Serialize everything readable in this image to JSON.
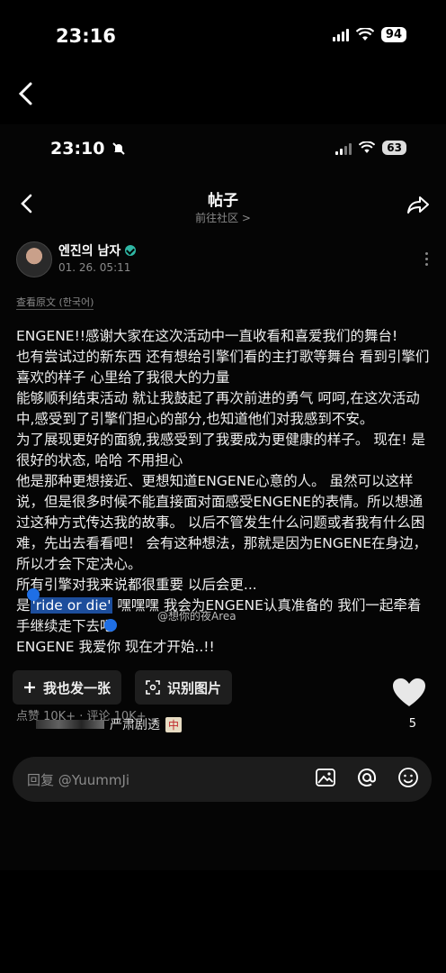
{
  "outer_status": {
    "time": "23:16",
    "battery": "94"
  },
  "inner_status": {
    "time": "23:10",
    "battery": "63"
  },
  "nav": {
    "title": "帖子",
    "subtitle": "前往社区 >"
  },
  "post": {
    "author": "엔진의 남자",
    "date": "01. 26. 05:11",
    "view_original": "查看原文 (한국어)",
    "paragraphs": [
      "ENGENE!!感谢大家在这次活动中一直收看和喜爱我们的舞台!",
      "也有尝试过的新东西 还有想给引擎们看的主打歌等舞台 看到引擎们喜欢的样子 心里给了我很大的力量",
      "能够顺利结束活动 就让我鼓起了再次前进的勇气 呵呵,在这次活动中,感受到了引擎们担心的部分,也知道他们对我感到不安。",
      "为了展现更好的面貌,我感受到了我要成为更健康的样子。 现在! 是很好的状态, 哈哈 不用担心",
      "他是那种更想接近、更想知道ENGENE心意的人。 虽然可以这样说，但是很多时候不能直接面对面感受ENGENE的表情。所以想通过这种方式传达我的故事。 以后不管发生什么问题或者我有什么困难，先出去看看吧！ 会有这种想法，那就是因为ENGENE在身边，所以才会下定决心。",
      "所有引擎对我来说都很重要 以后会更..."
    ],
    "line_pre": "是",
    "line_highlight": "'ride or die'",
    "line_post": " 嘿嘿嘿 我会为ENGENE认真准备的 我们一起牵着手继续走下去吧",
    "closing": "ENGENE 我爱你 现在才开始..!!",
    "stats": "点赞 10K+ · 评论 10K+"
  },
  "watermark": "@想你的夜Area",
  "actions": {
    "post_button": "我也发一张",
    "identify_button": "识别图片",
    "like_count": "5"
  },
  "bottom_strip": {
    "text": "严肃剧透",
    "badge": "中"
  },
  "reply": {
    "placeholder": "回复 @YuummJi"
  },
  "colors": {
    "accent_teal": "#2fb7a4",
    "selection_blue": "#1f6fe5"
  }
}
